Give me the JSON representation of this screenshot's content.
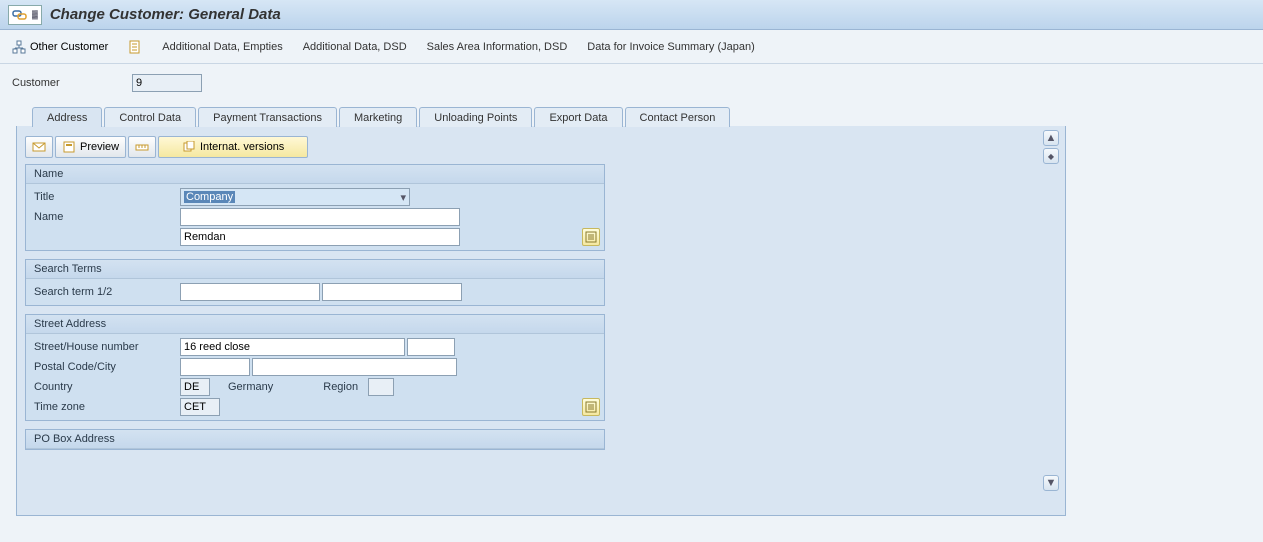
{
  "title": "Change Customer: General Data",
  "toolbar": {
    "other_customer": "Other Customer",
    "additional_empties": "Additional Data, Empties",
    "additional_dsd": "Additional Data, DSD",
    "sales_area_dsd": "Sales Area Information, DSD",
    "invoice_japan": "Data for Invoice Summary (Japan)"
  },
  "header": {
    "customer_label": "Customer",
    "customer_value": "9"
  },
  "tabs": [
    "Address",
    "Control Data",
    "Payment Transactions",
    "Marketing",
    "Unloading Points",
    "Export Data",
    "Contact Person"
  ],
  "active_tab": "Address",
  "inner_toolbar": {
    "preview": "Preview",
    "internat": "Internat. versions"
  },
  "groups": {
    "name": {
      "title": "Name",
      "title_label": "Title",
      "title_value": "Company",
      "name_label": "Name",
      "name_value": "",
      "name2_value": "Remdan"
    },
    "search": {
      "title": "Search Terms",
      "term_label": "Search term 1/2",
      "term1": "",
      "term2": ""
    },
    "street": {
      "title": "Street Address",
      "street_label": "Street/House number",
      "street_val": "16 reed close",
      "house_val": "",
      "postal_label": "Postal Code/City",
      "postal_val": "",
      "city_val": "",
      "country_label": "Country",
      "country_code": "DE",
      "country_name": "Germany",
      "region_label": "Region",
      "region_val": "",
      "tz_label": "Time zone",
      "tz_val": "CET"
    },
    "pobox": {
      "title": "PO Box Address"
    }
  }
}
